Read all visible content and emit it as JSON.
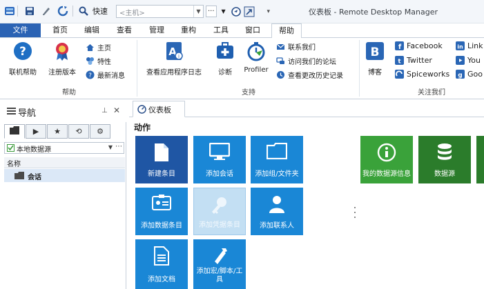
{
  "window": {
    "title": "仪表板 - Remote Desktop Manager",
    "quick_access": {
      "quick_label": "快速",
      "host_placeholder": "<主机>",
      "host_more": "···"
    }
  },
  "ribbon_tabs": [
    "文件",
    "首页",
    "编辑",
    "查看",
    "管理",
    "重构",
    "工具",
    "窗口",
    "帮助"
  ],
  "ribbon": {
    "help_group": {
      "label": "帮助",
      "online_help": "联机帮助",
      "register": "注册版本",
      "home": "主页",
      "features": "特性",
      "latest_news": "最新消息"
    },
    "support_group": {
      "label": "支持",
      "view_log": "查看应用程序日志",
      "diagnostics": "诊断",
      "profiler": "Profiler",
      "contact_us": "联系我们",
      "forum": "访问我们的论坛",
      "history": "查看更改历史记录"
    },
    "follow_group": {
      "label": "关注我们",
      "blog": "博客",
      "facebook": "Facebook",
      "twitter": "Twitter",
      "spiceworks": "Spiceworks",
      "linkedin": "Link",
      "youtube": "You",
      "google": "Goo"
    }
  },
  "nav": {
    "title": "导航",
    "source": "本地数据源",
    "column_name": "名称",
    "tree_item": "会话"
  },
  "dashboard": {
    "tab_label": "仪表板",
    "section_title": "动作",
    "tiles": [
      "新建条目",
      "添加会话",
      "添加组/文件夹",
      "添加数据条目",
      "添加凭据条目",
      "添加联系人",
      "添加文档",
      "添加宏/脚本/工具"
    ],
    "right_tiles": [
      "我的数据源信息",
      "数据源"
    ]
  },
  "colors": {
    "file_tab": "#2b63b4",
    "tile_blue": "#1a87d6",
    "tile_dark": "#1f56a4",
    "tile_green": "#3aa23a"
  }
}
